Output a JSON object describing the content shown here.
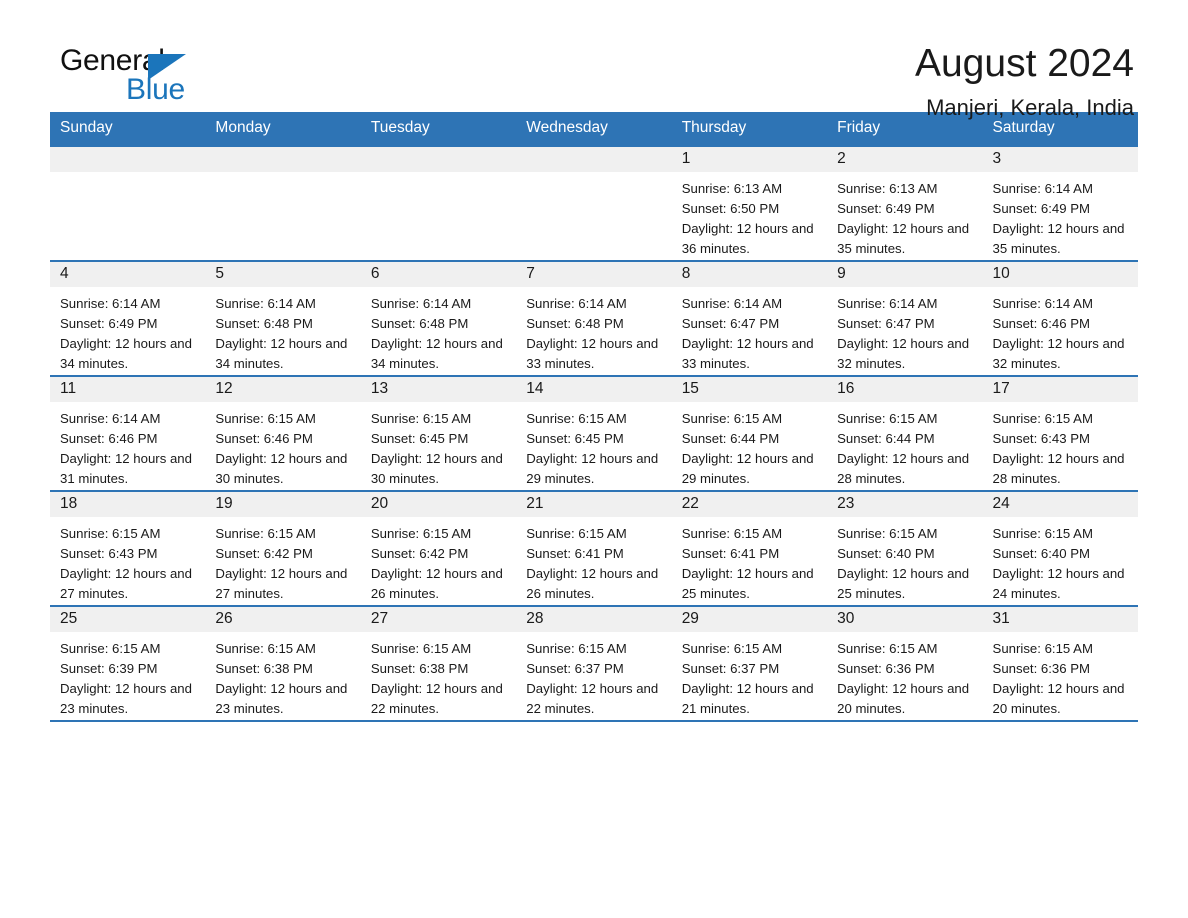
{
  "brand": {
    "name_part1": "General",
    "name_part2": "Blue",
    "accent_color": "#1b75bb"
  },
  "header": {
    "month_title": "August 2024",
    "location": "Manjeri, Kerala, India"
  },
  "calendar": {
    "header_color": "#2e74b5",
    "daynum_band_color": "#f0f0f0",
    "weekday_headers": [
      "Sunday",
      "Monday",
      "Tuesday",
      "Wednesday",
      "Thursday",
      "Friday",
      "Saturday"
    ],
    "weeks": [
      [
        {
          "day": "",
          "sunrise": "",
          "sunset": "",
          "daylight": ""
        },
        {
          "day": "",
          "sunrise": "",
          "sunset": "",
          "daylight": ""
        },
        {
          "day": "",
          "sunrise": "",
          "sunset": "",
          "daylight": ""
        },
        {
          "day": "",
          "sunrise": "",
          "sunset": "",
          "daylight": ""
        },
        {
          "day": "1",
          "sunrise": "Sunrise: 6:13 AM",
          "sunset": "Sunset: 6:50 PM",
          "daylight": "Daylight: 12 hours and 36 minutes."
        },
        {
          "day": "2",
          "sunrise": "Sunrise: 6:13 AM",
          "sunset": "Sunset: 6:49 PM",
          "daylight": "Daylight: 12 hours and 35 minutes."
        },
        {
          "day": "3",
          "sunrise": "Sunrise: 6:14 AM",
          "sunset": "Sunset: 6:49 PM",
          "daylight": "Daylight: 12 hours and 35 minutes."
        }
      ],
      [
        {
          "day": "4",
          "sunrise": "Sunrise: 6:14 AM",
          "sunset": "Sunset: 6:49 PM",
          "daylight": "Daylight: 12 hours and 34 minutes."
        },
        {
          "day": "5",
          "sunrise": "Sunrise: 6:14 AM",
          "sunset": "Sunset: 6:48 PM",
          "daylight": "Daylight: 12 hours and 34 minutes."
        },
        {
          "day": "6",
          "sunrise": "Sunrise: 6:14 AM",
          "sunset": "Sunset: 6:48 PM",
          "daylight": "Daylight: 12 hours and 34 minutes."
        },
        {
          "day": "7",
          "sunrise": "Sunrise: 6:14 AM",
          "sunset": "Sunset: 6:48 PM",
          "daylight": "Daylight: 12 hours and 33 minutes."
        },
        {
          "day": "8",
          "sunrise": "Sunrise: 6:14 AM",
          "sunset": "Sunset: 6:47 PM",
          "daylight": "Daylight: 12 hours and 33 minutes."
        },
        {
          "day": "9",
          "sunrise": "Sunrise: 6:14 AM",
          "sunset": "Sunset: 6:47 PM",
          "daylight": "Daylight: 12 hours and 32 minutes."
        },
        {
          "day": "10",
          "sunrise": "Sunrise: 6:14 AM",
          "sunset": "Sunset: 6:46 PM",
          "daylight": "Daylight: 12 hours and 32 minutes."
        }
      ],
      [
        {
          "day": "11",
          "sunrise": "Sunrise: 6:14 AM",
          "sunset": "Sunset: 6:46 PM",
          "daylight": "Daylight: 12 hours and 31 minutes."
        },
        {
          "day": "12",
          "sunrise": "Sunrise: 6:15 AM",
          "sunset": "Sunset: 6:46 PM",
          "daylight": "Daylight: 12 hours and 30 minutes."
        },
        {
          "day": "13",
          "sunrise": "Sunrise: 6:15 AM",
          "sunset": "Sunset: 6:45 PM",
          "daylight": "Daylight: 12 hours and 30 minutes."
        },
        {
          "day": "14",
          "sunrise": "Sunrise: 6:15 AM",
          "sunset": "Sunset: 6:45 PM",
          "daylight": "Daylight: 12 hours and 29 minutes."
        },
        {
          "day": "15",
          "sunrise": "Sunrise: 6:15 AM",
          "sunset": "Sunset: 6:44 PM",
          "daylight": "Daylight: 12 hours and 29 minutes."
        },
        {
          "day": "16",
          "sunrise": "Sunrise: 6:15 AM",
          "sunset": "Sunset: 6:44 PM",
          "daylight": "Daylight: 12 hours and 28 minutes."
        },
        {
          "day": "17",
          "sunrise": "Sunrise: 6:15 AM",
          "sunset": "Sunset: 6:43 PM",
          "daylight": "Daylight: 12 hours and 28 minutes."
        }
      ],
      [
        {
          "day": "18",
          "sunrise": "Sunrise: 6:15 AM",
          "sunset": "Sunset: 6:43 PM",
          "daylight": "Daylight: 12 hours and 27 minutes."
        },
        {
          "day": "19",
          "sunrise": "Sunrise: 6:15 AM",
          "sunset": "Sunset: 6:42 PM",
          "daylight": "Daylight: 12 hours and 27 minutes."
        },
        {
          "day": "20",
          "sunrise": "Sunrise: 6:15 AM",
          "sunset": "Sunset: 6:42 PM",
          "daylight": "Daylight: 12 hours and 26 minutes."
        },
        {
          "day": "21",
          "sunrise": "Sunrise: 6:15 AM",
          "sunset": "Sunset: 6:41 PM",
          "daylight": "Daylight: 12 hours and 26 minutes."
        },
        {
          "day": "22",
          "sunrise": "Sunrise: 6:15 AM",
          "sunset": "Sunset: 6:41 PM",
          "daylight": "Daylight: 12 hours and 25 minutes."
        },
        {
          "day": "23",
          "sunrise": "Sunrise: 6:15 AM",
          "sunset": "Sunset: 6:40 PM",
          "daylight": "Daylight: 12 hours and 25 minutes."
        },
        {
          "day": "24",
          "sunrise": "Sunrise: 6:15 AM",
          "sunset": "Sunset: 6:40 PM",
          "daylight": "Daylight: 12 hours and 24 minutes."
        }
      ],
      [
        {
          "day": "25",
          "sunrise": "Sunrise: 6:15 AM",
          "sunset": "Sunset: 6:39 PM",
          "daylight": "Daylight: 12 hours and 23 minutes."
        },
        {
          "day": "26",
          "sunrise": "Sunrise: 6:15 AM",
          "sunset": "Sunset: 6:38 PM",
          "daylight": "Daylight: 12 hours and 23 minutes."
        },
        {
          "day": "27",
          "sunrise": "Sunrise: 6:15 AM",
          "sunset": "Sunset: 6:38 PM",
          "daylight": "Daylight: 12 hours and 22 minutes."
        },
        {
          "day": "28",
          "sunrise": "Sunrise: 6:15 AM",
          "sunset": "Sunset: 6:37 PM",
          "daylight": "Daylight: 12 hours and 22 minutes."
        },
        {
          "day": "29",
          "sunrise": "Sunrise: 6:15 AM",
          "sunset": "Sunset: 6:37 PM",
          "daylight": "Daylight: 12 hours and 21 minutes."
        },
        {
          "day": "30",
          "sunrise": "Sunrise: 6:15 AM",
          "sunset": "Sunset: 6:36 PM",
          "daylight": "Daylight: 12 hours and 20 minutes."
        },
        {
          "day": "31",
          "sunrise": "Sunrise: 6:15 AM",
          "sunset": "Sunset: 6:36 PM",
          "daylight": "Daylight: 12 hours and 20 minutes."
        }
      ]
    ]
  }
}
